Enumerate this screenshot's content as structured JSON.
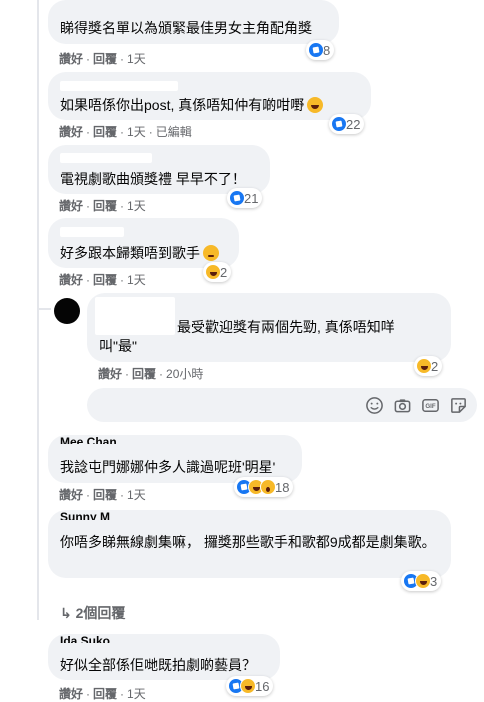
{
  "actions": {
    "like": "讚好",
    "reply": "回覆",
    "sep": "·"
  },
  "comments": [
    {
      "text": "睇得獎名單以為頒緊最佳男女主角配角獎",
      "time": "1天",
      "edited": "",
      "reaction_count": "8"
    },
    {
      "text": "如果唔係你出post, 真係唔知仲有啲咁嘢",
      "time": "1天",
      "edited": "已編輯",
      "reaction_count": "22"
    },
    {
      "text": "電視劇歌曲頒獎禮 早早不了！",
      "time": "1天",
      "edited": "",
      "reaction_count": "21"
    },
    {
      "text": "好多跟本歸類唔到歌手",
      "time": "1天",
      "edited": "",
      "reaction_count": "2"
    },
    {
      "text": "最受歡迎獎有兩個先勁, 真係唔知咩叫\"最\"",
      "time": "20小時",
      "edited": "",
      "reaction_count": "2"
    },
    {
      "author_fragment": "Mee Chan",
      "text": "我諗屯門娜娜仲多人識過呢班'明星'",
      "time": "1天",
      "edited": "",
      "reaction_count": "18"
    },
    {
      "author_fragment": "Sunny M",
      "text": "你唔多睇無線劇集嘛， 攞獎那些歌手和歌都9成都是劇集歌。",
      "time": "1天",
      "edited": "",
      "reaction_count": "3"
    },
    {
      "author_fragment": "Ida Suko",
      "text": "好似全部係佢哋既拍劇啲藝員？",
      "time": "1天",
      "edited": "",
      "reaction_count": "16"
    }
  ],
  "more_replies": "2個回覆",
  "icons": [
    "like-reaction-icon",
    "haha-reaction-icon",
    "wow-reaction-icon",
    "emoji-picker-icon",
    "camera-icon",
    "gif-icon",
    "sticker-icon",
    "reply-arrow-icon"
  ],
  "colors": {
    "bubble": "#f0f2f5",
    "meta": "#65676b",
    "like_blue": "#1877f2",
    "haha_yellow": "#f7b928"
  }
}
